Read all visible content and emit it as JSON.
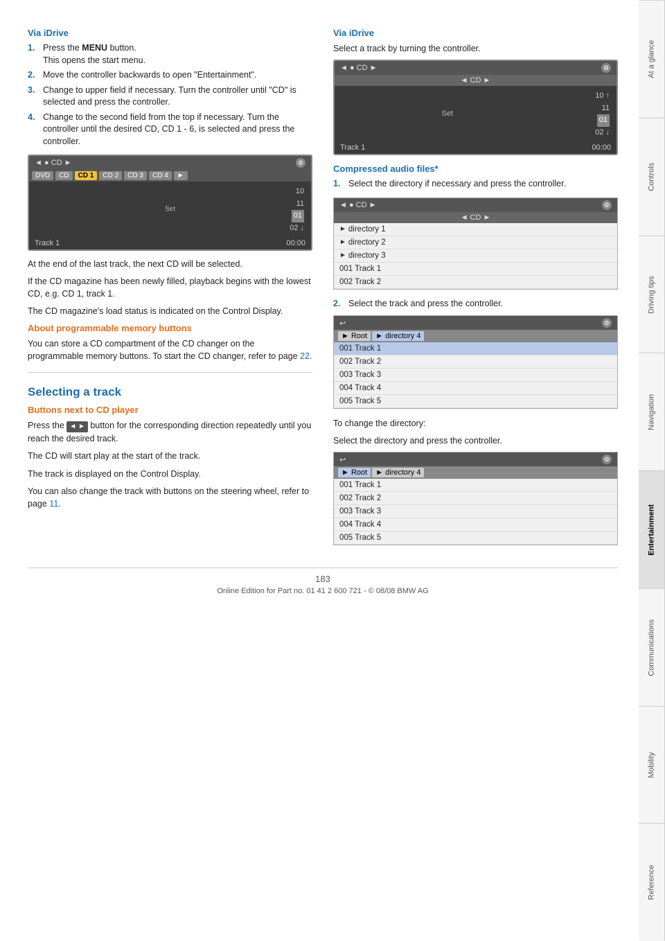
{
  "tabs": [
    {
      "label": "At a glance",
      "active": false
    },
    {
      "label": "Controls",
      "active": false
    },
    {
      "label": "Driving tips",
      "active": false
    },
    {
      "label": "Navigation",
      "active": false
    },
    {
      "label": "Entertainment",
      "active": true
    },
    {
      "label": "Communications",
      "active": false
    },
    {
      "label": "Mobility",
      "active": false
    },
    {
      "label": "Reference",
      "active": false
    }
  ],
  "left_col": {
    "via_idrive_title": "Via iDrive",
    "steps": [
      {
        "num": "1.",
        "text": "Press the MENU button.\nThis opens the start menu."
      },
      {
        "num": "2.",
        "text": "Move the controller backwards to open \"Entertainment\"."
      },
      {
        "num": "3.",
        "text": "Change to upper field if necessary. Turn the controller until \"CD\" is selected and press the controller."
      },
      {
        "num": "4.",
        "text": "Change to the second field from the top if necessary. Turn the controller until the desired CD, CD 1 - 6, is selected and press the controller."
      }
    ],
    "cd_display_left": {
      "header_left": "◄ ● CD ►",
      "header_right": "⚙",
      "tabs": [
        "DVD",
        "CD",
        "CD 1",
        "CD 2",
        "CD 3",
        "CD 4",
        "►"
      ],
      "active_tab": "CD 1",
      "track_numbers": [
        "10",
        "11",
        "01",
        "02"
      ],
      "active_track": "01",
      "set_label": "Set",
      "footer_left": "Track 1",
      "footer_right": "00:00"
    },
    "end_of_track_text": "At the end of the last track, the next CD will be selected.",
    "cd_magazine_text": "If the CD magazine has been newly filled, playback begins with the lowest CD, e.g. CD 1, track 1.",
    "load_status_text": "The CD magazine's load status is indicated on the Control Display.",
    "about_programmable_title": "About programmable memory buttons",
    "programmable_text": "You can store a CD compartment of the CD changer on the programmable memory buttons. To start the CD changer, refer to page",
    "programmable_page": "22",
    "selecting_track_title": "Selecting a track",
    "buttons_next_title": "Buttons next to CD player",
    "buttons_next_text1": "Press the",
    "buttons_next_icon": "◄ ►",
    "buttons_next_text2": "button for the corresponding direction repeatedly until you reach the desired track.",
    "buttons_next_text3": "The CD will start play at the start of the track.",
    "buttons_next_text4": "The track is displayed on the Control Display.",
    "buttons_next_text5": "You can also change the track with buttons on the steering wheel, refer to page",
    "buttons_next_page": "11"
  },
  "right_col": {
    "via_idrive_title": "Via iDrive",
    "via_idrive_text": "Select a track by turning the controller.",
    "cd_display_right": {
      "header_left": "◄ ● CD ►",
      "header_right": "⚙",
      "sub_header": "◄ CD ►",
      "track_numbers": [
        "10",
        "11",
        "01",
        "02"
      ],
      "active_track": "01",
      "set_label": "Set",
      "footer_left": "Track 1",
      "footer_right": "00:00"
    },
    "compressed_title": "Compressed audio files*",
    "compressed_step1": "Select the directory if necessary and press the controller.",
    "dir_display": {
      "header_left": "◄ ● CD ►",
      "header_right": "⚙",
      "sub_header": "◄ CD ►",
      "items": [
        {
          "label": "► directory 1",
          "highlight": false
        },
        {
          "label": "► directory 2",
          "highlight": false
        },
        {
          "label": "► directory 3",
          "highlight": false
        },
        {
          "label": "001 Track 1",
          "highlight": false
        },
        {
          "label": "002 Track 2",
          "highlight": false
        }
      ]
    },
    "compressed_step2": "Select the track and press the controller.",
    "path_display1": {
      "back_icon": "↩",
      "settings_icon": "⚙",
      "breadcrumb": [
        "Root",
        "directory 4"
      ],
      "active_crumb": "directory 4",
      "items": [
        {
          "label": "001 Track 1",
          "highlight": true
        },
        {
          "label": "002 Track 2",
          "highlight": false
        },
        {
          "label": "003 Track 3",
          "highlight": false
        },
        {
          "label": "004 Track 4",
          "highlight": false
        },
        {
          "label": "005 Track 5",
          "highlight": false
        }
      ]
    },
    "change_dir_text1": "To change the directory:",
    "change_dir_text2": "Select the directory and press the controller.",
    "path_display2": {
      "back_icon": "↩",
      "settings_icon": "⚙",
      "breadcrumb": [
        "Root",
        "directory 4"
      ],
      "active_crumb": "Root",
      "items": [
        {
          "label": "001 Track 1",
          "highlight": false
        },
        {
          "label": "002 Track 2",
          "highlight": false
        },
        {
          "label": "003 Track 3",
          "highlight": false
        },
        {
          "label": "004 Track 4",
          "highlight": false
        },
        {
          "label": "005 Track 5",
          "highlight": false
        }
      ]
    }
  },
  "footer": {
    "page_number": "183",
    "online_edition_text": "Online Edition for Part no. 01 41 2 600 721 - © 08/08 BMW AG"
  }
}
